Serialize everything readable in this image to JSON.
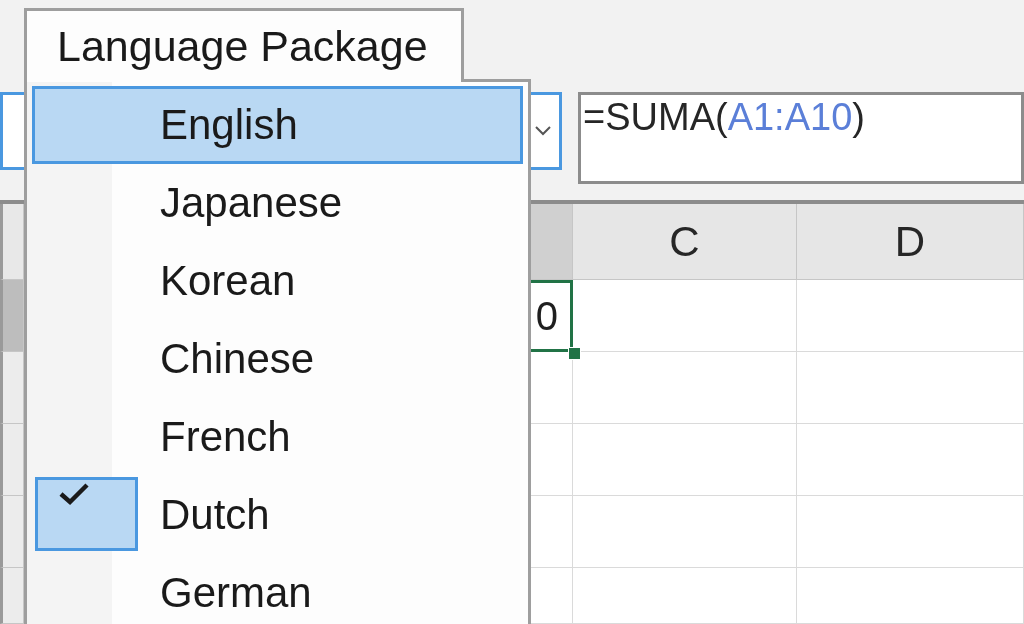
{
  "menu": {
    "title": "Language Package",
    "items": [
      {
        "label": "English",
        "selected": true,
        "checked": false
      },
      {
        "label": "Japanese",
        "selected": false,
        "checked": false
      },
      {
        "label": "Korean",
        "selected": false,
        "checked": false
      },
      {
        "label": "Chinese",
        "selected": false,
        "checked": false
      },
      {
        "label": "French",
        "selected": false,
        "checked": false
      },
      {
        "label": "Dutch",
        "selected": false,
        "checked": true
      },
      {
        "label": "German",
        "selected": false,
        "checked": false
      }
    ]
  },
  "name_box": {
    "focused": true
  },
  "formula_bar": {
    "tokens": [
      {
        "text": "=SUMA(",
        "kind": "text"
      },
      {
        "text": "A1:A10",
        "kind": "reference"
      },
      {
        "text": ")",
        "kind": "text"
      }
    ]
  },
  "sheet": {
    "columns": [
      {
        "selected": true
      },
      {
        "label": "C",
        "selected": false
      },
      {
        "label": "D",
        "selected": false
      }
    ],
    "rows": [
      {
        "selected": true
      },
      {
        "selected": false
      },
      {
        "selected": false
      },
      {
        "selected": false
      },
      {
        "selected": false
      }
    ],
    "active_cell": {
      "value": "0"
    }
  }
}
